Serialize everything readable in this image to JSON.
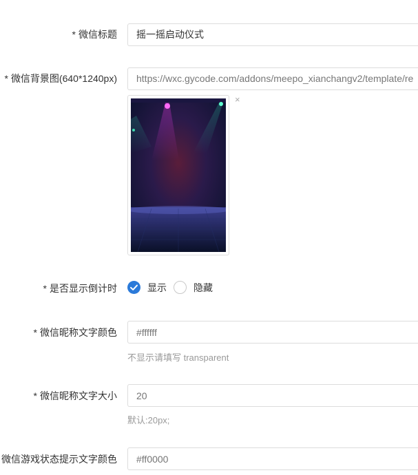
{
  "form": {
    "title_field": {
      "required_mark": "*",
      "label": "微信标题",
      "value": "摇一摇启动仪式"
    },
    "bg_field": {
      "required_mark": "*",
      "label": "微信背景图(640*1240px)",
      "value": "https://wxc.gycode.com/addons/meepo_xianchangv2/template/re",
      "remove_label": "×"
    },
    "countdown_field": {
      "required_mark": "*",
      "label": "是否显示倒计时",
      "options": [
        {
          "label": "显示",
          "checked": true
        },
        {
          "label": "隐藏",
          "checked": false
        }
      ]
    },
    "nickname_color_field": {
      "required_mark": "*",
      "label": "微信昵称文字颜色",
      "placeholder": "#ffffff",
      "help": "不显示请填写 transparent"
    },
    "nickname_size_field": {
      "required_mark": "*",
      "label": "微信昵称文字大小",
      "placeholder": "20",
      "help": "默认:20px;"
    },
    "game_status_color_field": {
      "required_mark": "*",
      "label": "微信游戏状态提示文字颜色",
      "placeholder": "#ff0000"
    }
  },
  "colors": {
    "accent": "#2b7ad9",
    "border": "#dcdcdc",
    "help_text": "#999999"
  }
}
